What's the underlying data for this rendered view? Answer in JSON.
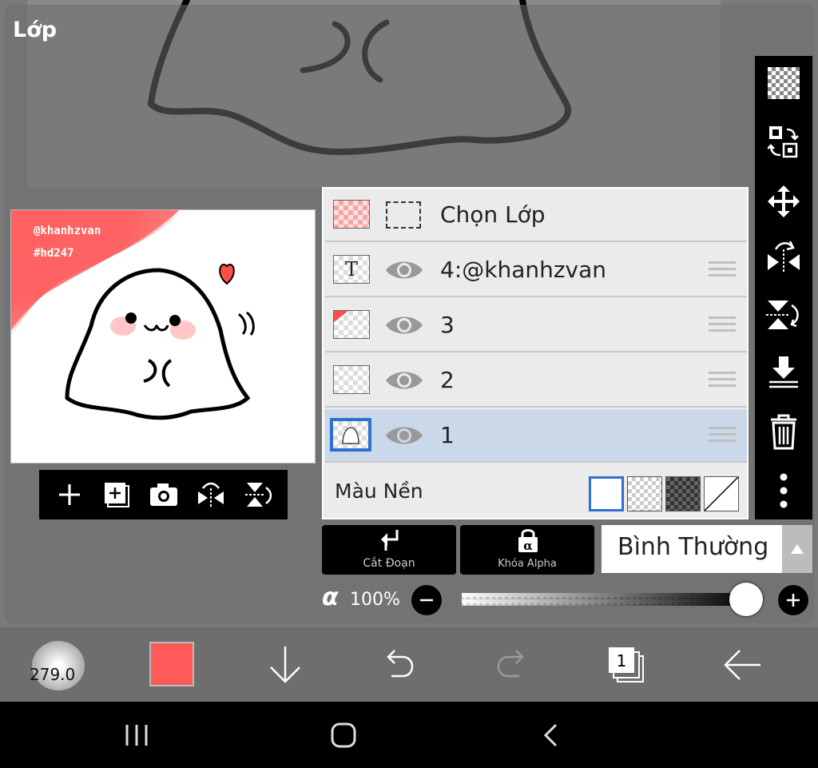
{
  "panel": {
    "title": "Lớp"
  },
  "preview": {
    "watermark_1": "@khanhzvan",
    "watermark_2": "#hd247"
  },
  "layers": {
    "select_layer_label": "Chọn Lớp",
    "items": [
      {
        "name": "4:@khanhzvan",
        "type": "text",
        "thumb_letter": "T"
      },
      {
        "name": "3",
        "type": "image"
      },
      {
        "name": "2",
        "type": "image"
      },
      {
        "name": "1",
        "type": "image",
        "selected": true
      }
    ],
    "background_label": "Màu Nền"
  },
  "controls": {
    "clip_label": "Cắt Đoạn",
    "alpha_lock_label": "Khóa Alpha",
    "blend_mode": "Bình Thường",
    "alpha_symbol": "α",
    "opacity": "100%",
    "opacity_value": 100
  },
  "bottom": {
    "brush_size": "279.0",
    "layer_count": "1",
    "color": "#ff5a5a"
  },
  "colors": {
    "accent": "#2f6fd0",
    "selected_row": "#cbd8ea"
  }
}
